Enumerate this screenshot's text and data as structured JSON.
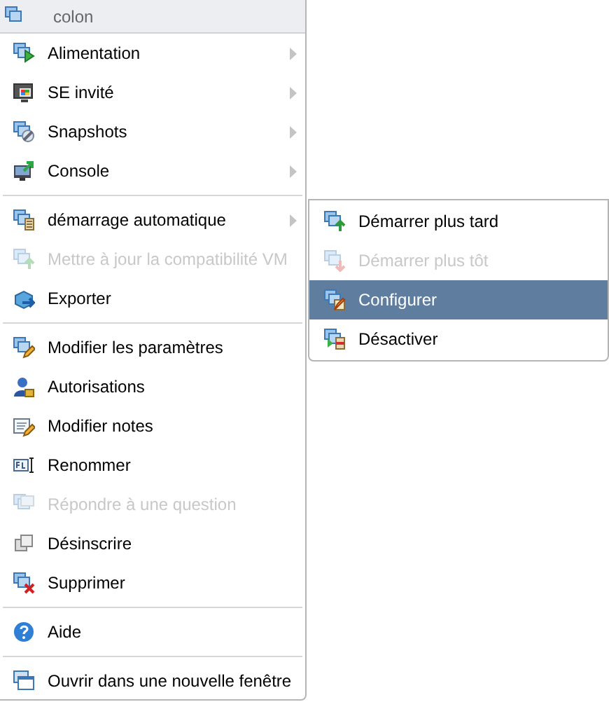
{
  "header": {
    "title": "colon"
  },
  "menu": [
    [
      {
        "label": "Alimentation",
        "disabled": false,
        "submenu": true
      },
      {
        "label": "SE invité",
        "disabled": false,
        "submenu": true
      },
      {
        "label": "Snapshots",
        "disabled": false,
        "submenu": true
      },
      {
        "label": "Console",
        "disabled": false,
        "submenu": true
      }
    ],
    [
      {
        "label": "démarrage automatique",
        "disabled": false,
        "submenu": true
      },
      {
        "label": "Mettre à jour la compatibilité VM",
        "disabled": true,
        "submenu": false
      },
      {
        "label": "Exporter",
        "disabled": false,
        "submenu": false
      }
    ],
    [
      {
        "label": "Modifier les paramètres",
        "disabled": false,
        "submenu": false
      },
      {
        "label": "Autorisations",
        "disabled": false,
        "submenu": false
      },
      {
        "label": "Modifier notes",
        "disabled": false,
        "submenu": false
      },
      {
        "label": "Renommer",
        "disabled": false,
        "submenu": false
      },
      {
        "label": "Répondre à une question",
        "disabled": true,
        "submenu": false
      },
      {
        "label": "Désinscrire",
        "disabled": false,
        "submenu": false
      },
      {
        "label": "Supprimer",
        "disabled": false,
        "submenu": false
      }
    ],
    [
      {
        "label": "Aide",
        "disabled": false,
        "submenu": false
      }
    ],
    [
      {
        "label": "Ouvrir dans une nouvelle fenêtre",
        "disabled": false,
        "submenu": false
      }
    ]
  ],
  "submenu": [
    {
      "label": "Démarrer plus tard",
      "disabled": false,
      "selected": false
    },
    {
      "label": "Démarrer plus tôt",
      "disabled": true,
      "selected": false
    },
    {
      "label": "Configurer",
      "disabled": false,
      "selected": true
    },
    {
      "label": "Désactiver",
      "disabled": false,
      "selected": false
    }
  ]
}
